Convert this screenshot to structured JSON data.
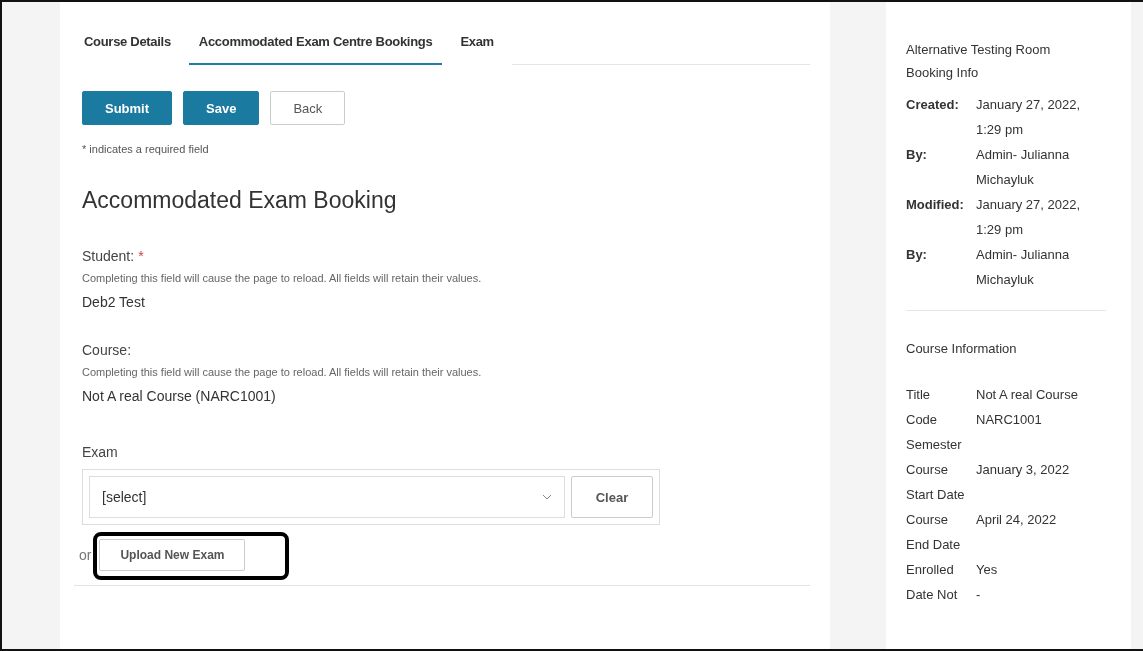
{
  "tabs": [
    {
      "label": "Course Details",
      "selected": false
    },
    {
      "label": "Accommodated Exam Centre Bookings",
      "selected": true
    },
    {
      "label": "Exam",
      "selected": false
    }
  ],
  "actions": [
    {
      "label": "Submit",
      "kind": "primary"
    },
    {
      "label": "Save",
      "kind": "primary"
    },
    {
      "label": "Back",
      "kind": "secondary"
    }
  ],
  "required_note": "* indicates a required field",
  "heading": "Accommodated Exam Booking",
  "fields": [
    {
      "label": "Student:",
      "required_mark": "*",
      "hint": "Completing this field will cause the page to reload. All fields will retain their values.",
      "value": "Deb2 Test"
    },
    {
      "label": "Course:",
      "hint": "Completing this field will cause the page to reload. All fields will retain their values.",
      "value": "Not A real Course (NARC1001)"
    }
  ],
  "exam": {
    "label": "Exam",
    "select_value": "[select]",
    "clear_button": "Clear",
    "or_text": "or",
    "upload_button": "Upload New Exam",
    "upload_highlighted": true
  },
  "booking_info": {
    "title": "Alternative Testing Room Booking Info",
    "rows": [
      {
        "label": "Created:",
        "value": "January 27, 2022, 1:29 pm"
      },
      {
        "label": "By:",
        "value": "Admin- Julianna Michayluk"
      },
      {
        "label": "Modified:",
        "value": "January 27, 2022, 1:29 pm"
      },
      {
        "label": "By:",
        "value": "Admin- Julianna Michayluk"
      }
    ]
  },
  "course_info": {
    "title": "Course Information",
    "rows": [
      {
        "label": "Title",
        "value": "Not A real Course"
      },
      {
        "label": "Code",
        "value": "NARC1001"
      },
      {
        "label": "Semester"
      },
      {
        "label": "Course Start Date",
        "value": "January 3, 2022"
      },
      {
        "label": "Course End Date",
        "value": "April 24, 2022"
      },
      {
        "label": "Enrolled",
        "value": "Yes"
      },
      {
        "label": "Date Not",
        "value": "-"
      }
    ]
  }
}
